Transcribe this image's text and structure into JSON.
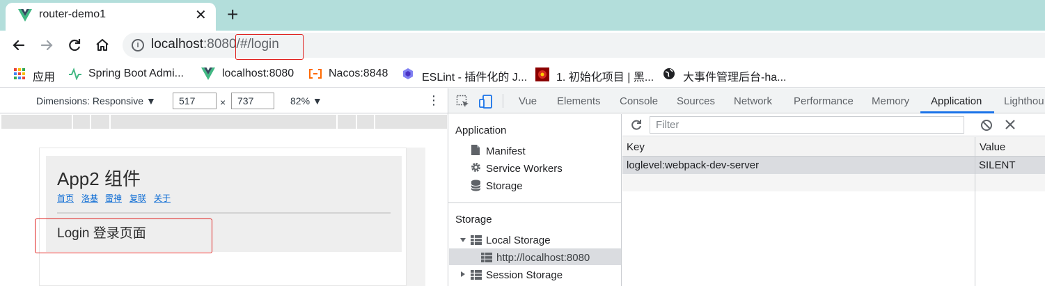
{
  "browser": {
    "tab_title": "router-demo1",
    "tab_close": "✕",
    "new_tab": "+",
    "url_host": "localhost",
    "url_rest": ":8080/#/login"
  },
  "bookmarks": [
    {
      "label": "应用",
      "icon": "apps-grid-icon"
    },
    {
      "label": "Spring Boot Admi...",
      "icon": "spring-boot-admin-icon"
    },
    {
      "label": "localhost:8080",
      "icon": "vue-logo-icon"
    },
    {
      "label": "Nacos:8848",
      "icon": "nacos-icon"
    },
    {
      "label": "ESLint - 插件化的 J...",
      "icon": "eslint-icon"
    },
    {
      "label": "1. 初始化项目 | 黑...",
      "icon": "red-site-icon"
    },
    {
      "label": "大事件管理后台-ha...",
      "icon": "globe-icon"
    }
  ],
  "device_toolbar": {
    "dimensions_label": "Dimensions: Responsive ▼",
    "width": "517",
    "times": "×",
    "height": "737",
    "zoom": "82% ▼",
    "more": "⋮"
  },
  "page": {
    "title": "App2 组件",
    "nav_links": [
      "首页",
      "洛基",
      "雷神",
      "复联",
      "关于"
    ],
    "content": "Login 登录页面"
  },
  "devtools": {
    "tabs": [
      "Vue",
      "Elements",
      "Console",
      "Sources",
      "Network",
      "Performance",
      "Memory",
      "Application",
      "Lighthou"
    ],
    "active_tab": "Application",
    "sidebar": {
      "app_header": "Application",
      "app_items": [
        "Manifest",
        "Service Workers",
        "Storage"
      ],
      "storage_header": "Storage",
      "local_storage": "Local Storage",
      "local_storage_origin": "http://localhost:8080",
      "session_storage": "Session Storage"
    },
    "filter_placeholder": "Filter",
    "table": {
      "columns": [
        "Key",
        "Value"
      ],
      "rows": [
        [
          "loglevel:webpack-dev-server",
          "SILENT"
        ]
      ]
    }
  },
  "colors": {
    "tab_strip": "#b3dedb",
    "highlight_box": "#e0211f",
    "link": "#0b6bd4",
    "devtools_accent": "#1a73e8"
  }
}
